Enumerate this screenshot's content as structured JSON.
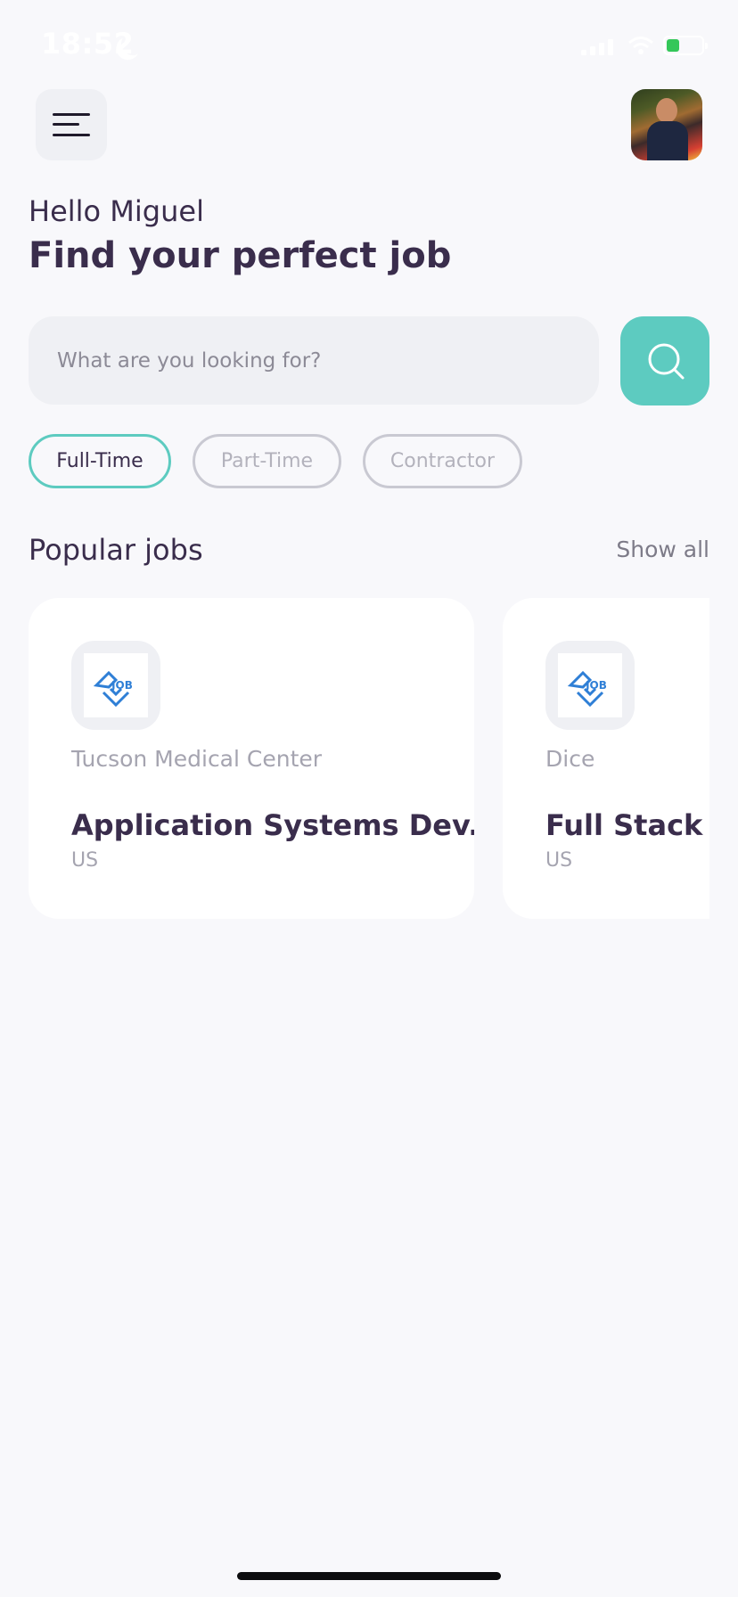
{
  "status_bar": {
    "time": "18:52"
  },
  "header": {
    "menu_icon": "hamburger-menu-icon",
    "avatar_alt": "Profile photo"
  },
  "greeting": "Hello Miguel",
  "headline": "Find your perfect job",
  "search": {
    "placeholder": "What are you looking for?",
    "value": "",
    "icon": "search-icon"
  },
  "filters": [
    {
      "label": "Full-Time",
      "active": true
    },
    {
      "label": "Part-Time",
      "active": false
    },
    {
      "label": "Contractor",
      "active": false
    }
  ],
  "popular_jobs": {
    "title": "Popular jobs",
    "show_all": "Show all",
    "jobs": [
      {
        "company": "Tucson Medical Center",
        "title": "Application Systems Dev...",
        "location": "US",
        "logo": "job-logo-icon"
      },
      {
        "company": "Dice",
        "title": "Full Stack Developer",
        "location": "US",
        "logo": "job-logo-icon"
      }
    ]
  },
  "colors": {
    "accent": "#5dcbc0",
    "text": "#3a2d4c",
    "muted": "#a5a4b0",
    "background": "#f8f8fb"
  }
}
